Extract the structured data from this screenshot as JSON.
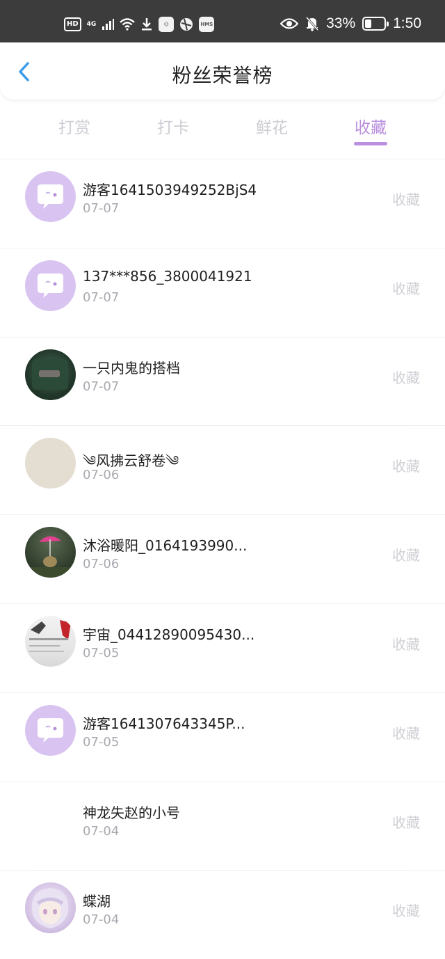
{
  "status_bar": {
    "hd": "HD",
    "network": "4G",
    "hms": "HMS",
    "battery": "33%",
    "battery_level": 0.33,
    "time": "1:50"
  },
  "header": {
    "title": "粉丝荣誉榜"
  },
  "tabs": [
    {
      "label": "打赏",
      "active": false
    },
    {
      "label": "打卡",
      "active": false
    },
    {
      "label": "鲜花",
      "active": false
    },
    {
      "label": "收藏",
      "active": true
    }
  ],
  "colors": {
    "accent": "#b98fdf",
    "status_bar": "#3c3c3c",
    "default_avatar": "#d9c4f1"
  },
  "fans": [
    {
      "name": "游客1641503949252BjS4",
      "date": "07-07",
      "action": "收藏",
      "avatar": "default-chat-icon"
    },
    {
      "name": "137***856_3800041921",
      "date": "07-07",
      "action": "收藏",
      "avatar": "default-chat-icon"
    },
    {
      "name": "一只内鬼的搭档",
      "date": "07-07",
      "action": "收藏",
      "avatar": "photo-avatar"
    },
    {
      "name": "༄风拂云舒卷༄",
      "date": "07-06",
      "action": "收藏",
      "avatar": "photo-avatar"
    },
    {
      "name": "沐浴暖阳_0164193990...",
      "date": "07-06",
      "action": "收藏",
      "avatar": "photo-avatar"
    },
    {
      "name": "宇宙_04412890095430...",
      "date": "07-05",
      "action": "收藏",
      "avatar": "photo-avatar"
    },
    {
      "name": "游客1641307643345P...",
      "date": "07-05",
      "action": "收藏",
      "avatar": "default-chat-icon"
    },
    {
      "name": "神龙失赵的小号",
      "date": "07-04",
      "action": "收藏",
      "avatar": "none"
    },
    {
      "name": "蝶湖",
      "date": "07-04",
      "action": "收藏",
      "avatar": "photo-avatar"
    }
  ]
}
